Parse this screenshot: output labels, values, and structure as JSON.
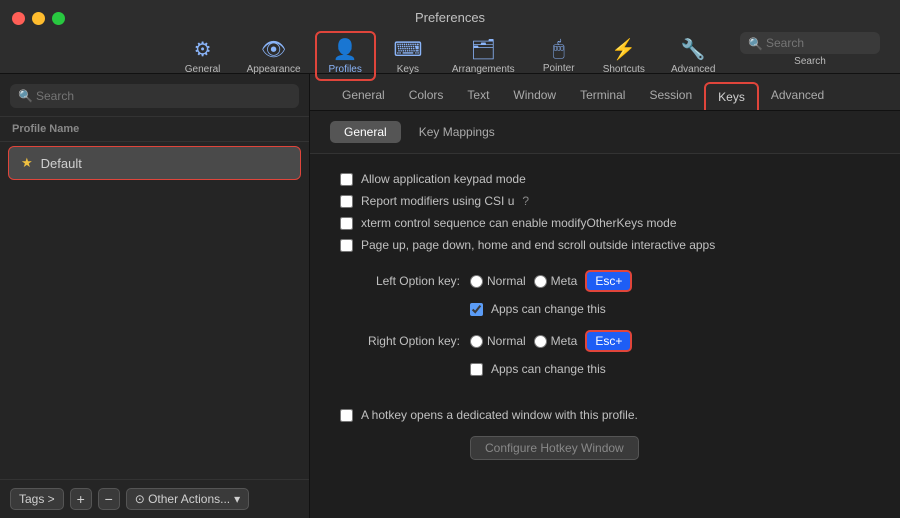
{
  "window": {
    "title": "Preferences"
  },
  "toolbar": {
    "items": [
      {
        "id": "general",
        "label": "General",
        "icon": "⚙"
      },
      {
        "id": "appearance",
        "label": "Appearance",
        "icon": "👁"
      },
      {
        "id": "profiles",
        "label": "Profiles",
        "icon": "👤",
        "active": true
      },
      {
        "id": "keys",
        "label": "Keys",
        "icon": "⌨"
      },
      {
        "id": "arrangements",
        "label": "Arrangements",
        "icon": "🗂"
      },
      {
        "id": "pointer",
        "label": "Pointer",
        "icon": "🖱"
      },
      {
        "id": "shortcuts",
        "label": "Shortcuts",
        "icon": "⚡"
      },
      {
        "id": "advanced",
        "label": "Advanced",
        "icon": "🔧"
      }
    ],
    "search_placeholder": "Search",
    "search_label": "Search"
  },
  "sidebar": {
    "search_placeholder": "Search",
    "profile_name_header": "Profile Name",
    "profiles": [
      {
        "name": "Default",
        "default": true,
        "selected": true
      }
    ],
    "footer": {
      "tags_label": "Tags >",
      "add_label": "+",
      "remove_label": "−",
      "other_actions_label": "⊙ Other Actions...",
      "other_actions_chevron": "▾"
    }
  },
  "profile_tabs": [
    {
      "id": "general",
      "label": "General"
    },
    {
      "id": "colors",
      "label": "Colors"
    },
    {
      "id": "text",
      "label": "Text"
    },
    {
      "id": "window",
      "label": "Window"
    },
    {
      "id": "terminal",
      "label": "Terminal"
    },
    {
      "id": "session",
      "label": "Session"
    },
    {
      "id": "keys",
      "label": "Keys",
      "active": true
    },
    {
      "id": "advanced",
      "label": "Advanced"
    }
  ],
  "sub_tabs": [
    {
      "id": "general",
      "label": "General",
      "active": true
    },
    {
      "id": "key_mappings",
      "label": "Key Mappings"
    }
  ],
  "settings": {
    "checkboxes": [
      {
        "id": "app_keypad",
        "label": "Allow application keypad mode",
        "checked": false
      },
      {
        "id": "report_modifiers",
        "label": "Report modifiers using CSI u",
        "checked": false,
        "has_help": true
      },
      {
        "id": "xterm_control",
        "label": "xterm control sequence can enable modifyOtherKeys mode",
        "checked": false
      },
      {
        "id": "page_scroll",
        "label": "Page up, page down, home and end scroll outside interactive apps",
        "checked": false
      }
    ],
    "left_option_key": {
      "label": "Left Option key:",
      "options": [
        {
          "id": "normal",
          "label": "Normal",
          "checked": false
        },
        {
          "id": "meta",
          "label": "Meta",
          "checked": false
        },
        {
          "id": "esc",
          "label": "Esc+",
          "checked": true,
          "highlighted": true
        }
      ],
      "apps_can_change": true
    },
    "right_option_key": {
      "label": "Right Option key:",
      "options": [
        {
          "id": "normal",
          "label": "Normal",
          "checked": false
        },
        {
          "id": "meta",
          "label": "Meta",
          "checked": false
        },
        {
          "id": "esc",
          "label": "Esc+",
          "checked": true,
          "highlighted": true
        }
      ],
      "apps_can_change": false
    },
    "hotkey": {
      "checkbox_label": "A hotkey opens a dedicated window with this profile.",
      "checked": false,
      "configure_btn_label": "Configure Hotkey Window"
    }
  }
}
